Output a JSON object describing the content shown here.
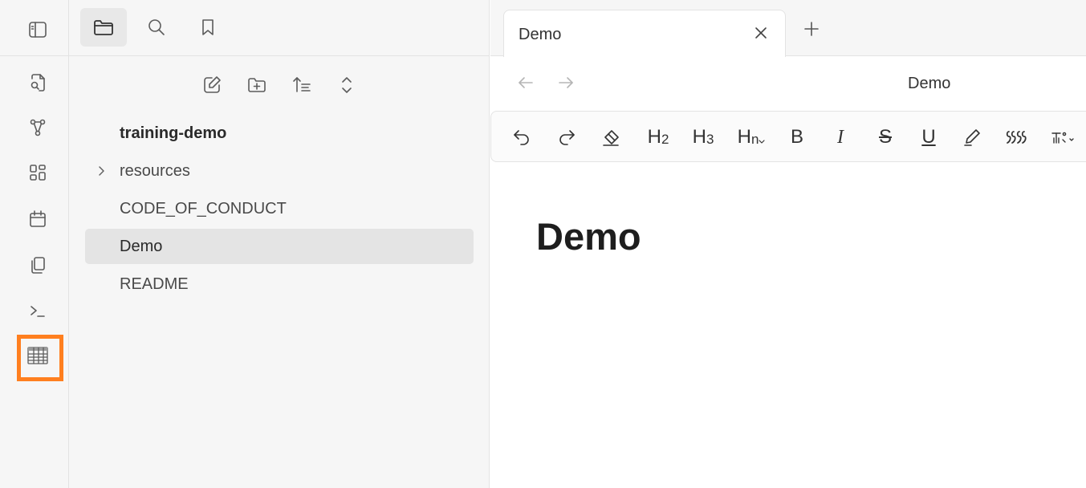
{
  "ribbon": {
    "icons": [
      "sidebar-toggle-icon",
      "open-quick-switcher-icon",
      "graph-view-icon",
      "canvas-icon",
      "daily-note-calendar-icon",
      "templates-icon",
      "command-palette-icon",
      "table-icon"
    ],
    "highlight_color": "#ff7f1f"
  },
  "explorer": {
    "header_icons": [
      "folder-icon",
      "search-icon",
      "bookmark-icon"
    ],
    "actions": [
      "new-note-icon",
      "new-folder-icon",
      "sort-icon",
      "collapse-expand-icon"
    ],
    "tree": [
      {
        "label": "training-demo",
        "type": "root"
      },
      {
        "label": "resources",
        "type": "folder"
      },
      {
        "label": "CODE_OF_CONDUCT",
        "type": "file"
      },
      {
        "label": "Demo",
        "type": "file",
        "active": true
      },
      {
        "label": "README",
        "type": "file"
      }
    ]
  },
  "tabs": [
    {
      "label": "Demo"
    }
  ],
  "navbar": {
    "title": "Demo"
  },
  "toolbar": {
    "h2_main": "H",
    "h2_sub": "2",
    "h3_main": "H",
    "h3_sub": "3",
    "hn_main": "H",
    "hn_sub": "n",
    "bold": "B",
    "italic": "I",
    "strike": "S",
    "underline": "U"
  },
  "document": {
    "heading": "Demo"
  }
}
